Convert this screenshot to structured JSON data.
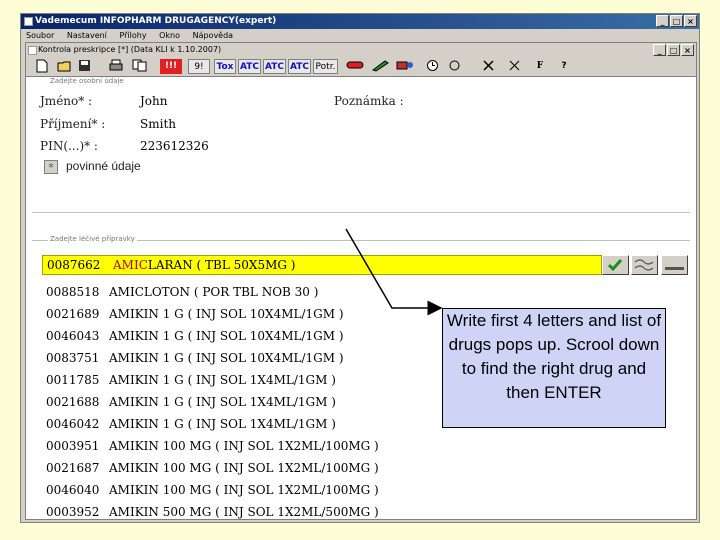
{
  "app": {
    "title": "Vademecum INFOPHARM DRUGAGENCY(expert)",
    "menu": [
      "Soubor",
      "Nastavení",
      "Přílohy",
      "Okno",
      "Nápověda"
    ]
  },
  "child": {
    "title": "Kontrola preskripce [*] (Data KLI k 1.10.2007)"
  },
  "toolbar": {
    "red_label": "!!!",
    "num_label": "9!",
    "tox_label": "Tox",
    "atc1_label": "ATC",
    "atc2_label": "ATC",
    "atc3_label": "ATC",
    "potr_label": "Potr."
  },
  "patient": {
    "legend": "Zadejte osobní údaje",
    "first_name_label": "Jméno* :",
    "first_name": "John",
    "last_name_label": "Příjmení* :",
    "last_name": "Smith",
    "pin_label": "PIN(...)* :",
    "pin": "223612326",
    "notes_label": "Poznámka :",
    "required_label": "povinné údaje",
    "required_marker": "*"
  },
  "drugs": {
    "legend": "Zadejte léčivé přípravky",
    "search_code": "0087662",
    "search_typed": "AMIC",
    "search_rest": "LARAN  ( TBL 50X5MG )",
    "rows": [
      {
        "code": "0088518",
        "name": "AMICLOTON   ( POR TBL NOB 30 )"
      },
      {
        "code": "0021689",
        "name": "AMIKIN 1 G   ( INJ SOL 10X4ML/1GM )"
      },
      {
        "code": "0046043",
        "name": "AMIKIN 1 G   ( INJ SOL 10X4ML/1GM )"
      },
      {
        "code": "0083751",
        "name": "AMIKIN 1 G   ( INJ SOL 10X4ML/1GM )"
      },
      {
        "code": "0011785",
        "name": "AMIKIN 1 G   ( INJ SOL 1X4ML/1GM )"
      },
      {
        "code": "0021688",
        "name": "AMIKIN 1 G   ( INJ SOL 1X4ML/1GM )"
      },
      {
        "code": "0046042",
        "name": "AMIKIN 1 G   ( INJ SOL 1X4ML/1GM )"
      },
      {
        "code": "0003951",
        "name": "AMIKIN 100 MG   ( INJ SOL 1X2ML/100MG )"
      },
      {
        "code": "0021687",
        "name": "AMIKIN 100 MG   ( INJ SOL 1X2ML/100MG )"
      },
      {
        "code": "0046040",
        "name": "AMIKIN 100 MG   ( INJ SOL 1X2ML/100MG )"
      },
      {
        "code": "0003952",
        "name": "AMIKIN 500 MG   ( INJ SOL 1X2ML/500MG )"
      }
    ]
  },
  "callout": {
    "text": "Write first 4 letters and list of drugs pops up. Scrool down to find the right drug and then ENTER"
  },
  "colors": {
    "slide_bg": "#fdfdd6",
    "search_bg": "#ffff00",
    "callout_bg": "#cfd3f6",
    "titlebar": "#0a246a"
  }
}
